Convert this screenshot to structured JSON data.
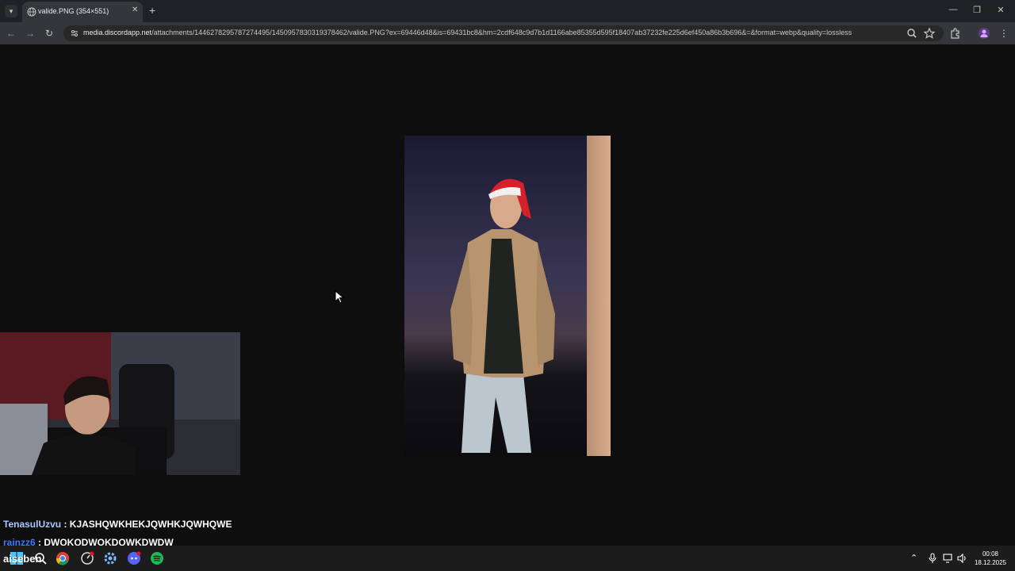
{
  "browser": {
    "tab_title": "valide.PNG (354×551)",
    "url_host": "media.discordapp.net",
    "url_path": "/attachments/1446278295787274495/1450957830319378462/valide.PNG?ex=69446d48&is=69431bc8&hm=2cdf648c9d7b1d1166abe85355d595f18407ab37232fe225d6ef450a86b3b696&=&format=webp&quality=lossless"
  },
  "chat": [
    {
      "user": "TenasulUzvu",
      "sep": " : ",
      "message": "KJASHQWKHEKJQWHKJQWHQWE",
      "user_color": "#a9c8ff"
    },
    {
      "user": "rainzz6",
      "sep": " : ",
      "message": "DWQKQDWOKDQWKDWDW",
      "user_color": "#3b7bff"
    }
  ],
  "taskbar": {
    "overlay_text": "aiseben",
    "time": "00:08",
    "date": "18.12.2025"
  },
  "colors": {
    "background": "#0e0e0e",
    "tabbar": "#202124",
    "toolbar": "#35363a"
  }
}
